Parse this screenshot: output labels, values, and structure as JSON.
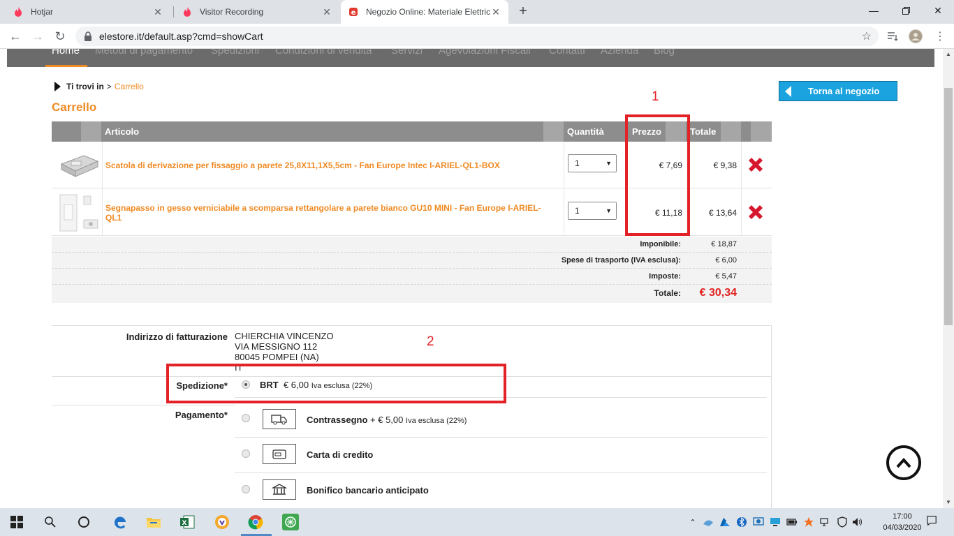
{
  "browser": {
    "tabs": [
      {
        "title": "Hotjar",
        "active": false
      },
      {
        "title": "Visitor Recording",
        "active": false
      },
      {
        "title": "Negozio Online: Materiale Elettrico",
        "active": true
      }
    ],
    "url": "elestore.it/default.asp?cmd=showCart"
  },
  "site_nav": {
    "items": [
      "Home",
      "Metodi di pagamento",
      "Spedizioni",
      "Condizioni di vendita",
      "Servizi",
      "Agevolazioni Fiscali",
      "Contatti",
      "Azienda",
      "Blog"
    ],
    "active": "Home"
  },
  "breadcrumb": {
    "label": "Ti trovi in",
    "sep": ">",
    "current": "Carrello"
  },
  "page_title": "Carrello",
  "back_button": "Torna al negozio",
  "cart": {
    "headers": {
      "article": "Articolo",
      "qty": "Quantità",
      "price": "Prezzo",
      "total": "Totale"
    },
    "items": [
      {
        "name": "Scatola di derivazione per fissaggio a parete 25,8X11,1X5,5cm - Fan Europe Intec I-ARIEL-QL1-BOX",
        "qty": "1",
        "price": "€ 7,69",
        "total": "€ 9,38"
      },
      {
        "name": "Segnapasso in gesso verniciabile a scomparsa rettangolare a parete bianco GU10 MINI - Fan Europe I-ARIEL-QL1",
        "qty": "1",
        "price": "€ 11,18",
        "total": "€ 13,64"
      }
    ],
    "summary": [
      {
        "label": "Imponibile:",
        "value": "€ 18,87"
      },
      {
        "label": "Spese di trasporto (IVA esclusa):",
        "value": "€ 6,00"
      },
      {
        "label": "Imposte:",
        "value": "€ 5,47"
      }
    ],
    "grand_total": {
      "label": "Totale:",
      "value": "€ 30,34"
    }
  },
  "checkout": {
    "billing_label": "Indirizzo di fatturazione",
    "billing_address": [
      "CHIERCHIA VINCENZO",
      "VIA MESSIGNO 112",
      "80045 POMPEI (NA)",
      "IT"
    ],
    "shipping_label": "Spedizione*",
    "shipping_option": {
      "carrier": "BRT",
      "price": "€ 6,00",
      "note": "Iva esclusa (22%)"
    },
    "payment_label": "Pagamento*",
    "payment_options": [
      {
        "name": "Contrassegno",
        "extra": "+ € 5,00",
        "note": "Iva esclusa (22%)",
        "icon": "delivery-truck-icon"
      },
      {
        "name": "Carta di credito",
        "extra": "",
        "note": "",
        "icon": "credit-card-icon"
      },
      {
        "name": "Bonifico bancario anticipato",
        "extra": "",
        "note": "",
        "icon": "bank-icon"
      }
    ]
  },
  "annotations": [
    "1",
    "2"
  ],
  "taskbar": {
    "time": "17:00",
    "date": "04/03/2020"
  },
  "colors": {
    "accent": "#f08a24",
    "annotation": "#e32228",
    "button": "#1aa3de",
    "total": "#e02020"
  }
}
